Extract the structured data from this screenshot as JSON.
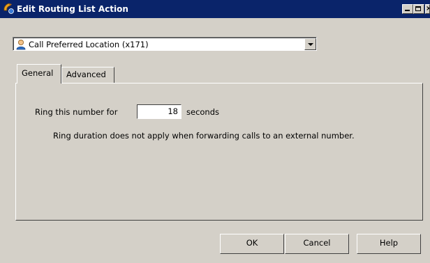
{
  "window": {
    "title": "Edit Routing List Action",
    "icon": "routing-phone-icon",
    "controls": [
      "minimize-icon",
      "maximize-icon",
      "close-icon"
    ]
  },
  "action_select": {
    "selected": "Call Preferred Location (x171)",
    "icon": "user-icon"
  },
  "tabs": [
    {
      "label": "General",
      "active": true
    },
    {
      "label": "Advanced",
      "active": false
    }
  ],
  "general": {
    "ring_label": "Ring this number for",
    "ring_value": "18",
    "ring_unit": "seconds",
    "note": "Ring duration does not apply when forwarding calls to an external number."
  },
  "buttons": {
    "ok": "OK",
    "cancel": "Cancel",
    "help": "Help"
  },
  "colors": {
    "titlebar": "#0a246a",
    "face": "#d4d0c8"
  }
}
